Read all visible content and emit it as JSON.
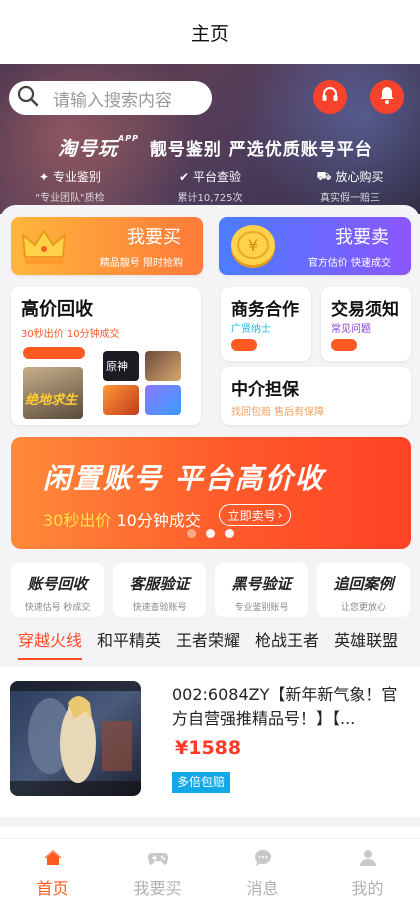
{
  "header": {
    "title": "主页"
  },
  "search": {
    "placeholder": "请输入搜索内容"
  },
  "hero": {
    "brand": "淘号玩",
    "brand_sup": "APP",
    "slogan": "靓号鉴别  严选优质账号平台",
    "features": [
      {
        "title": "专业鉴别",
        "sub": "\"专业团队\"质检",
        "icon": "fingerprint-icon"
      },
      {
        "title": "平台查验",
        "sub": "累计10,725次",
        "icon": "shield-check-icon"
      },
      {
        "title": "放心购买",
        "sub": "真实假一赔三",
        "icon": "car-icon"
      }
    ]
  },
  "buy_card": {
    "title": "我要买",
    "sub": "精品靓号 限时抢购"
  },
  "sell_card": {
    "title": "我要卖",
    "sub": "官方估价 快速成交"
  },
  "recycle_card": {
    "title": "高价回收",
    "sub": "30秒出价 10分钟成交",
    "game_label": "绝地求生",
    "game2_label": "原神"
  },
  "cooperation_card": {
    "title": "商务合作",
    "sub": "广贤纳士"
  },
  "notice_card": {
    "title": "交易须知",
    "sub": "常见问题"
  },
  "escrow_card": {
    "title": "中介担保",
    "sub": "找回包赔 售后有保障"
  },
  "banner": {
    "title": "闲置账号 平台高价收",
    "sub_highlight": "30秒出价",
    "sub_rest": " 10分钟成交",
    "button": "立即卖号"
  },
  "services": [
    {
      "title": "账号回收",
      "sub": "快速估号 秒成交"
    },
    {
      "title": "客服验证",
      "sub": "快速查验账号"
    },
    {
      "title": "黑号验证",
      "sub": "专业鉴别账号"
    },
    {
      "title": "追回案例",
      "sub": "让您更放心"
    }
  ],
  "tabs": [
    "穿越火线",
    "和平精英",
    "王者荣耀",
    "枪战王者",
    "英雄联盟"
  ],
  "product": {
    "title": "002:6084ZY【新年新气象！官方自营强推精品号！】【...",
    "price": "¥1588",
    "tag": "多倍包赔"
  },
  "nav": [
    {
      "label": "首页",
      "icon": "home-icon"
    },
    {
      "label": "我要买",
      "icon": "gamepad-icon"
    },
    {
      "label": "消息",
      "icon": "message-icon"
    },
    {
      "label": "我的",
      "icon": "user-icon"
    }
  ],
  "colors": {
    "accent": "#ff5a22",
    "price": "#ff3a26",
    "tag": "#12a8e8"
  }
}
